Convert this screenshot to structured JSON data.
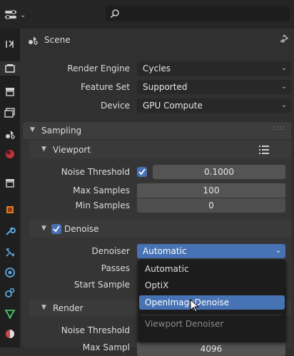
{
  "header": {
    "editor_type_icon": "properties-icon",
    "search_placeholder": ""
  },
  "breadcrumb": {
    "icon": "scene-icon",
    "label": "Scene"
  },
  "tabs": [
    {
      "name": "tool-icon"
    },
    {
      "name": "render-icon"
    },
    {
      "name": "output-icon"
    },
    {
      "name": "view-layer-icon"
    },
    {
      "name": "scene-icon"
    },
    {
      "name": "world-icon"
    },
    {
      "name": "collection-icon"
    },
    {
      "name": "object-icon"
    },
    {
      "name": "modifier-icon"
    },
    {
      "name": "particles-icon"
    },
    {
      "name": "physics-icon"
    },
    {
      "name": "constraints-icon"
    },
    {
      "name": "data-icon"
    },
    {
      "name": "material-icon"
    }
  ],
  "render_engine": {
    "label": "Render Engine",
    "value": "Cycles"
  },
  "feature_set": {
    "label": "Feature Set",
    "value": "Supported"
  },
  "device": {
    "label": "Device",
    "value": "GPU Compute"
  },
  "sampling": {
    "title": "Sampling",
    "viewport": {
      "title": "Viewport",
      "noise_threshold": {
        "label": "Noise Threshold",
        "value": "0.1000",
        "checked": true
      },
      "max_samples": {
        "label": "Max Samples",
        "value": "100"
      },
      "min_samples": {
        "label": "Min Samples",
        "value": "0"
      },
      "denoise": {
        "title": "Denoise",
        "checked": true,
        "denoiser": {
          "label": "Denoiser",
          "value": "Automatic"
        },
        "passes": {
          "label": "Passes"
        },
        "start_sample": {
          "label": "Start Sample"
        }
      }
    },
    "render": {
      "title": "Render",
      "noise_threshold": {
        "label": "Noise Threshold"
      },
      "max_samples_partial": {
        "label": "Max Sampl",
        "value": "4096"
      }
    }
  },
  "denoiser_menu": {
    "items": [
      "Automatic",
      "OptiX",
      "OpenImageDenoise"
    ],
    "highlighted": "OpenImageDenoise",
    "footer": "Viewport Denoiser"
  },
  "colors": {
    "accent": "#4772b3",
    "bg": "#303030",
    "field": "#545454"
  }
}
